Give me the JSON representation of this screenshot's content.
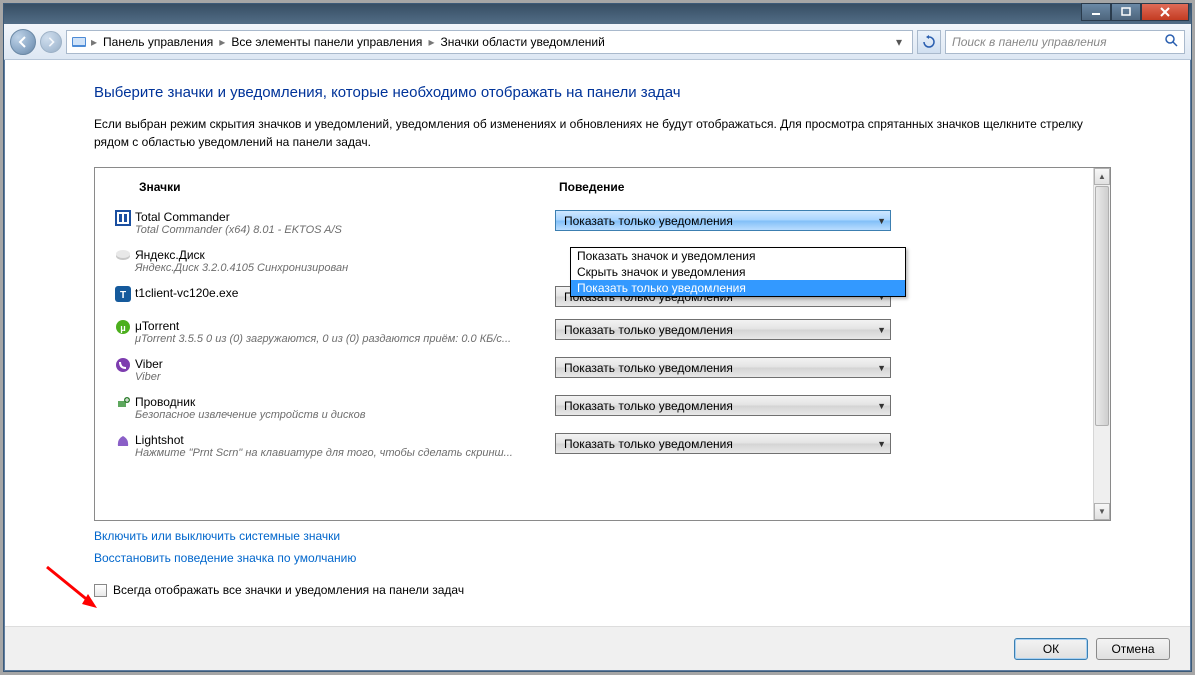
{
  "breadcrumb": {
    "seg1": "Панель управления",
    "seg2": "Все элементы панели управления",
    "seg3": "Значки области уведомлений"
  },
  "search": {
    "placeholder": "Поиск в панели управления"
  },
  "page": {
    "title": "Выберите значки и уведомления, которые необходимо отображать на панели задач",
    "desc": "Если выбран режим скрытия значков и уведомлений, уведомления об изменениях и обновлениях не будут отображаться. Для просмотра спрятанных значков щелкните стрелку рядом с областью уведомлений на панели задач."
  },
  "headers": {
    "icons": "Значки",
    "behavior": "Поведение"
  },
  "dropdown": {
    "opt1": "Показать значок и уведомления",
    "opt2": "Скрыть значок и уведомления",
    "opt3": "Показать только уведомления"
  },
  "items": [
    {
      "name": "Total Commander",
      "sub": "Total Commander (x64) 8.01 - EKTOS A/S",
      "value": "Показать только уведомления",
      "open": true
    },
    {
      "name": "Яндекс.Диск",
      "sub": "Яндекс.Диск 3.2.0.4105 Синхронизирован",
      "value": ""
    },
    {
      "name": "t1client-vc120e.exe",
      "sub": "",
      "value": "Показать только уведомления"
    },
    {
      "name": "μTorrent",
      "sub": "μTorrent 3.5.5   0 из (0) загружаются, 0 из (0) раздаются  приём: 0.0 КБ/с...",
      "value": "Показать только уведомления"
    },
    {
      "name": "Viber",
      "sub": "Viber",
      "value": "Показать только уведомления"
    },
    {
      "name": "Проводник",
      "sub": "Безопасное извлечение устройств и дисков",
      "value": "Показать только уведомления"
    },
    {
      "name": "Lightshot",
      "sub": "Нажмите \"Prnt Scrn\" на клавиатуре для того, чтобы сделать скринш...",
      "value": "Показать только уведомления"
    }
  ],
  "links": {
    "l1": "Включить или выключить системные значки",
    "l2": "Восстановить поведение значка по умолчанию"
  },
  "checkbox": {
    "label": "Всегда отображать все значки и уведомления на панели задач"
  },
  "buttons": {
    "ok": "ОК",
    "cancel": "Отмена"
  }
}
